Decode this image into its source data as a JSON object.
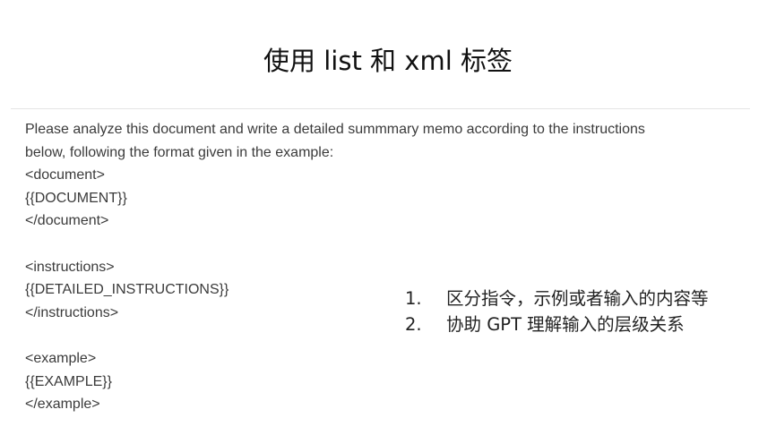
{
  "title": "使用 list 和 xml 标签",
  "prompt": {
    "lines": [
      "Please analyze this document and write a detailed summmary memo according to the instructions",
      "below, following the format given in the example:",
      "<document>",
      "{{DOCUMENT}}",
      "</document>",
      "",
      "<instructions>",
      "{{DETAILED_INSTRUCTIONS}}",
      "</instructions>",
      "",
      "<example>",
      "{{EXAMPLE}}",
      "</example>"
    ]
  },
  "notes": [
    {
      "num": "1.",
      "text": "区分指令，示例或者输入的内容等"
    },
    {
      "num": "2.",
      "text": "协助 GPT 理解输入的层级关系"
    }
  ]
}
